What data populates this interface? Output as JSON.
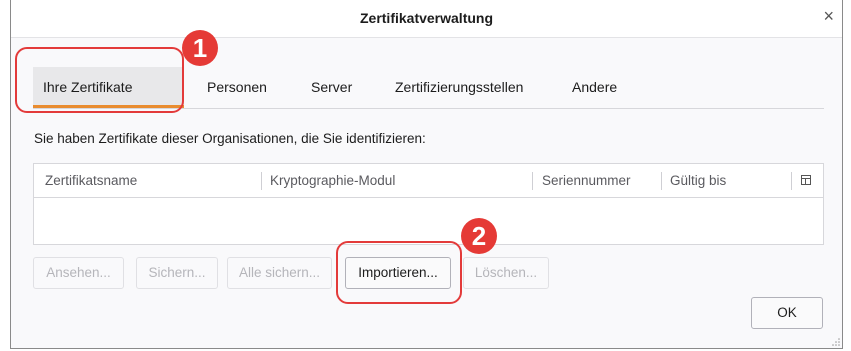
{
  "window": {
    "title": "Zertifikatverwaltung",
    "close_glyph": "×"
  },
  "tabs": [
    {
      "label": "Ihre Zertifikate",
      "active": true
    },
    {
      "label": "Personen"
    },
    {
      "label": "Server"
    },
    {
      "label": "Zertifizierungsstellen"
    },
    {
      "label": "Andere"
    }
  ],
  "description": "Sie haben Zertifikate dieser Organisationen, die Sie identifizieren:",
  "table": {
    "columns": [
      "Zertifikatsname",
      "Kryptographie-Modul",
      "Seriennummer",
      "Gültig bis"
    ],
    "rows": []
  },
  "buttons": {
    "view": {
      "label": "Ansehen..."
    },
    "backup": {
      "label": "Sichern..."
    },
    "backup_all": {
      "label": "Alle sichern..."
    },
    "import": {
      "label": "Importieren..."
    },
    "delete": {
      "label": "Löschen..."
    },
    "ok": {
      "label": "OK"
    }
  },
  "annotations": [
    {
      "number": "1"
    },
    {
      "number": "2"
    }
  ],
  "colors": {
    "highlight": "#e33a3a",
    "active_tab_underline": "#e98c2f"
  }
}
